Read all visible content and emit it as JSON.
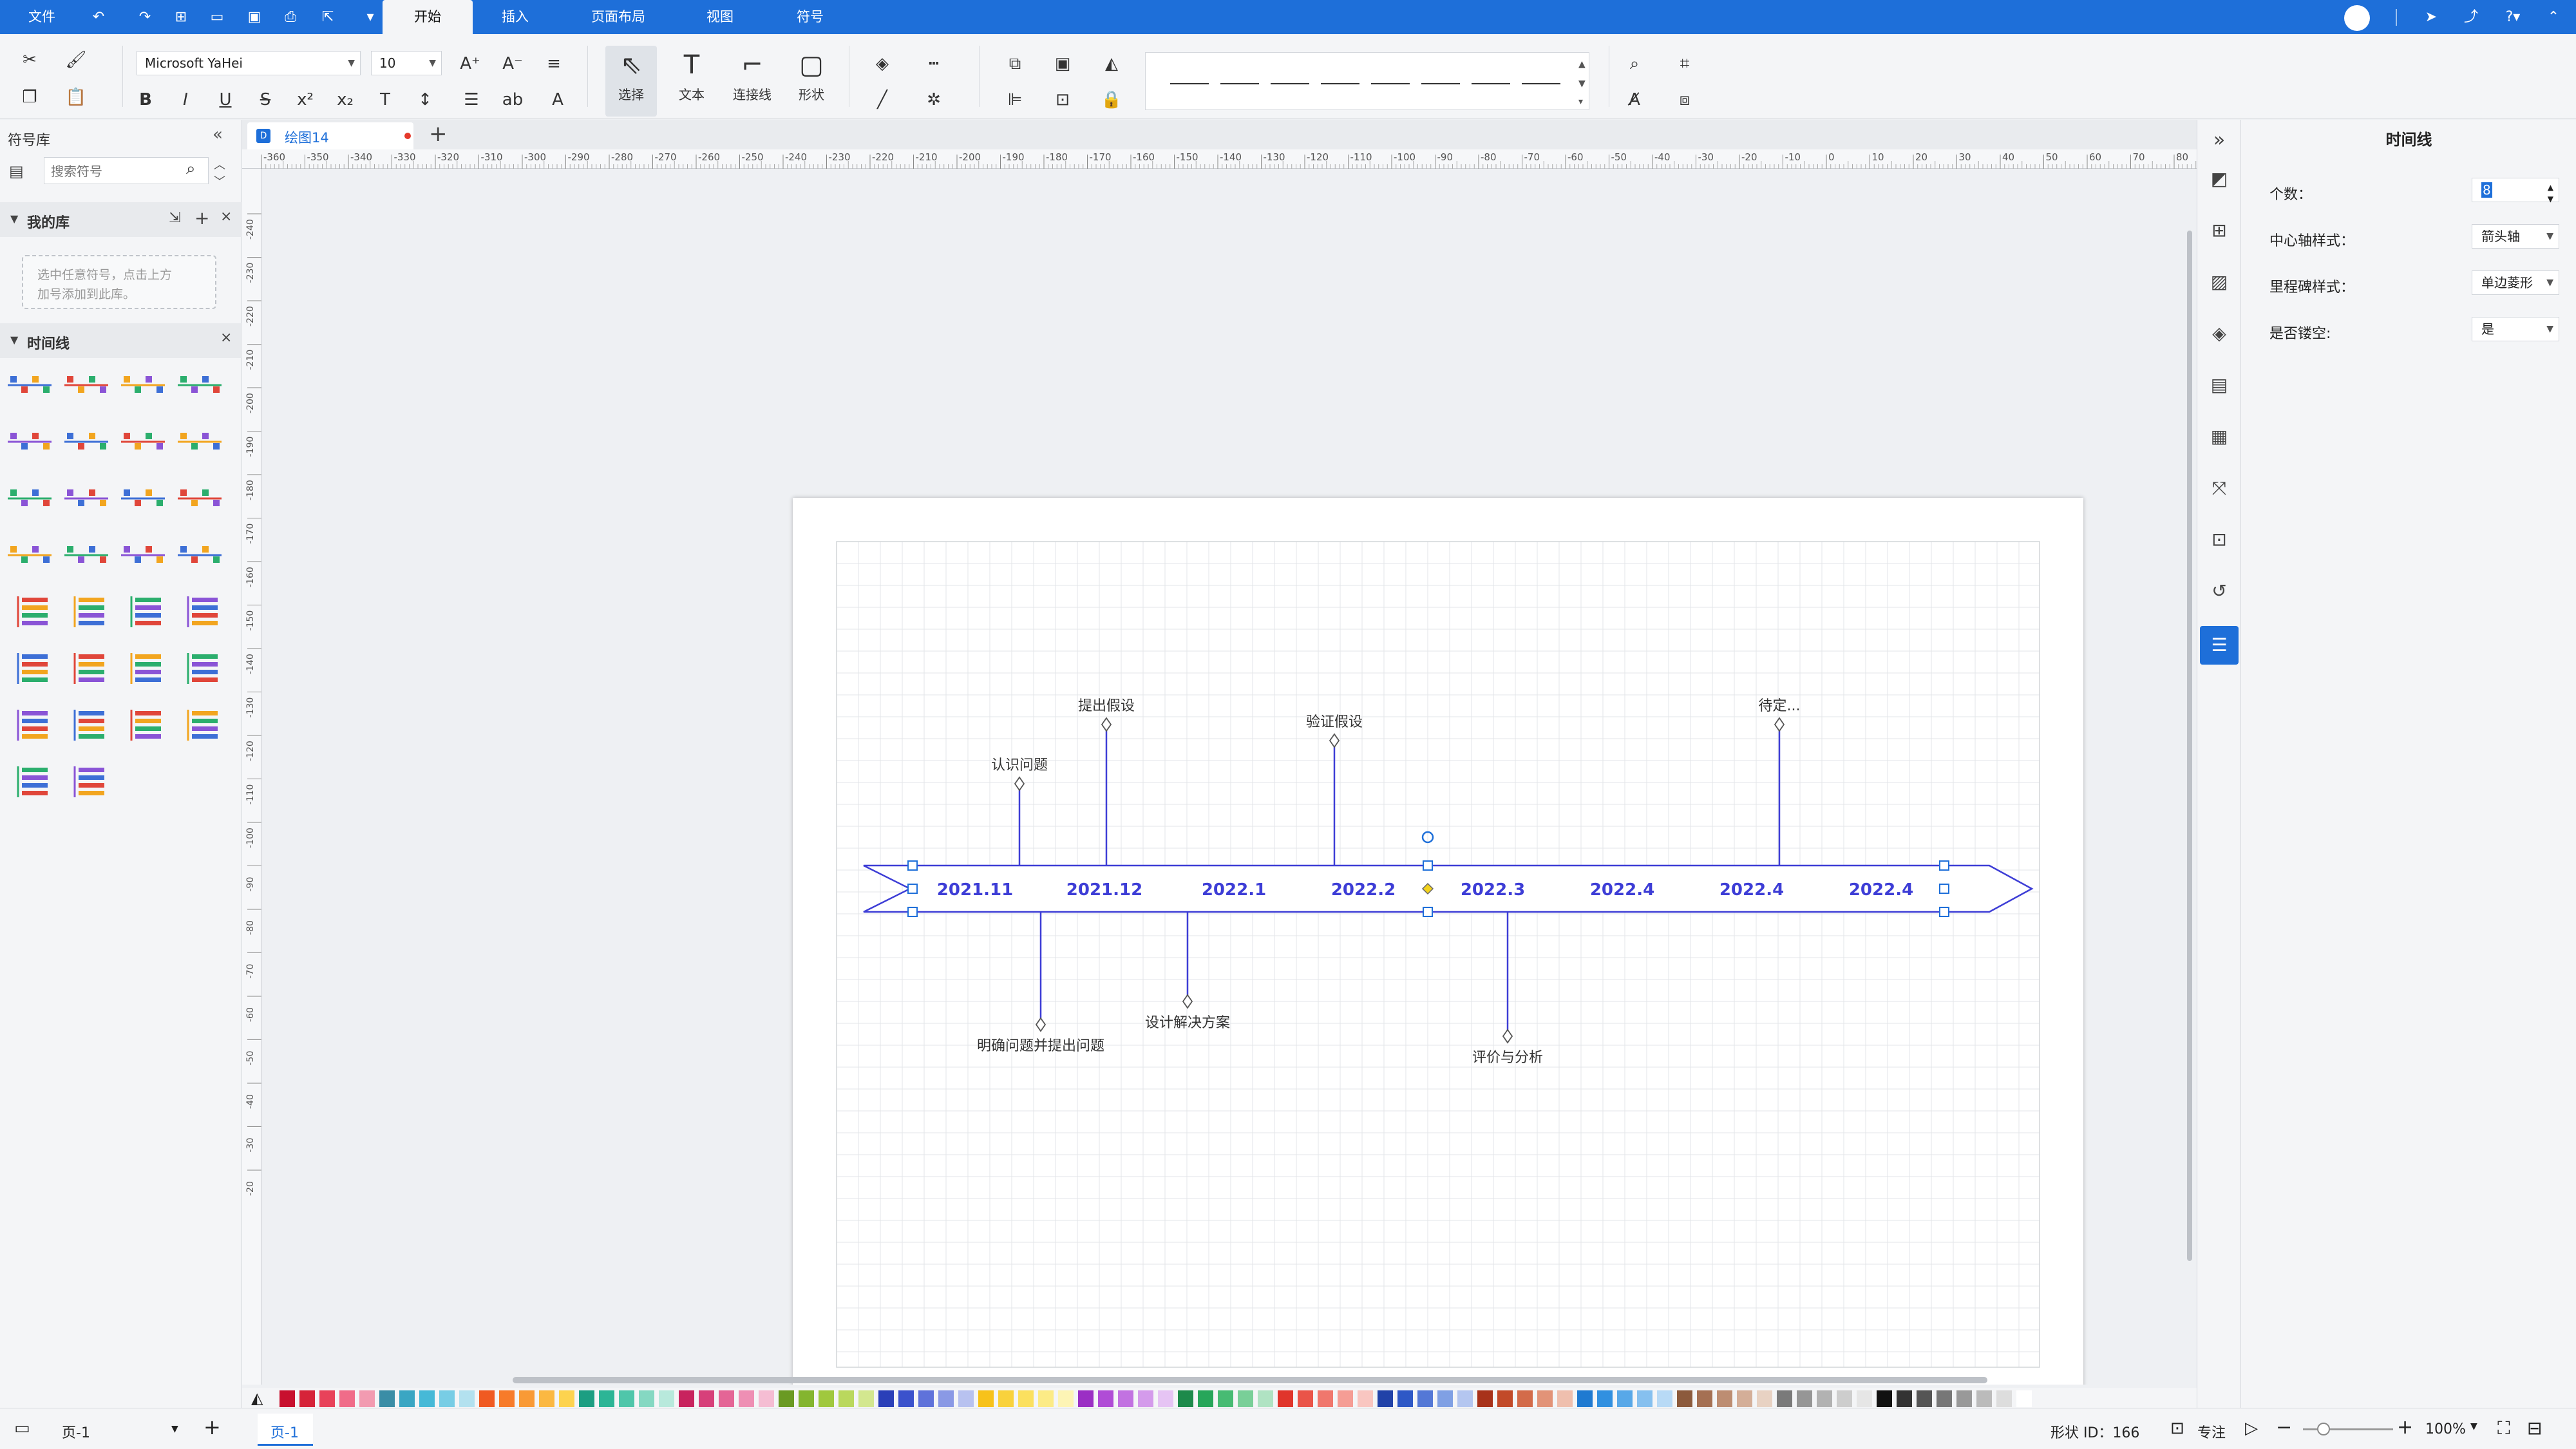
{
  "menu": {
    "file": "文件",
    "tabs": [
      {
        "label": "开始",
        "active": true
      },
      {
        "label": "插入",
        "active": false
      },
      {
        "label": "页面布局",
        "active": false
      },
      {
        "label": "视图",
        "active": false
      },
      {
        "label": "符号",
        "active": false
      }
    ]
  },
  "ribbon": {
    "font_family": "Microsoft YaHei",
    "font_size": "10",
    "select_label": "选择",
    "text_label": "文本",
    "connector_label": "连接线",
    "shape_label": "形状"
  },
  "library": {
    "title": "符号库",
    "search_placeholder": "搜索符号",
    "my_library": "我的库",
    "my_library_hint_line1": "选中任意符号，点击上方",
    "my_library_hint_line2": "加号添加到此库。",
    "timeline_section": "时间线"
  },
  "document": {
    "tab_title": "绘图14"
  },
  "ruler": {
    "h_labels": [
      "-360",
      "-350",
      "-340",
      "-330",
      "-320",
      "-310",
      "-300",
      "-290",
      "-280",
      "-270",
      "-260",
      "-250",
      "-240",
      "-230",
      "-220",
      "-210",
      "-200",
      "-190",
      "-180",
      "-170",
      "-160",
      "-150",
      "-140",
      "-130",
      "-120",
      "-110",
      "-100",
      "-90",
      "-80",
      "-70",
      "-60",
      "-50",
      "-40",
      "-30",
      "-20",
      "-10",
      "0",
      "10",
      "20",
      "30",
      "40",
      "50",
      "60",
      "70",
      "80"
    ],
    "v_labels": [
      "-240",
      "-230",
      "-220",
      "-210",
      "-200",
      "-190",
      "-180",
      "-170",
      "-160",
      "-150",
      "-140",
      "-130",
      "-120",
      "-110",
      "-100",
      "-90",
      "-80",
      "-70",
      "-60",
      "-50",
      "-40",
      "-30",
      "-20"
    ]
  },
  "timeline": {
    "dates": [
      "2021.11",
      "2021.12",
      "2022.1",
      "2022.2",
      "2022.3",
      "2022.4",
      "2022.4",
      "2022.4"
    ],
    "milestones_above": [
      "认识问题",
      "提出假设",
      "验证假设",
      "待定..."
    ],
    "milestones_below": [
      "明确问题并提出问题",
      "设计解决方案",
      "评价与分析"
    ],
    "accent_color": "#3d3dd6"
  },
  "properties": {
    "title": "时间线",
    "count_label": "个数：",
    "count_value": "8",
    "axis_style_label": "中心轴样式：",
    "axis_style_value": "箭头轴",
    "milestone_style_label": "里程碑样式：",
    "milestone_style_value": "单边菱形",
    "hollow_label": "是否镂空:",
    "hollow_value": "是"
  },
  "status": {
    "page_select": "页-1",
    "page_tab": "页-1",
    "shape_id": "形状 ID：166",
    "focus": "专注",
    "zoom": "100%"
  },
  "colors": {
    "brand": "#1e6fd9",
    "palette": [
      "#c8102e",
      "#d62339",
      "#e8425a",
      "#f06c89",
      "#f29bb1",
      "#3a8da6",
      "#3aa6c3",
      "#46b9d7",
      "#78cde5",
      "#b3e1ef",
      "#f05a22",
      "#f77b2a",
      "#f99a36",
      "#fbb842",
      "#fdd34f",
      "#1c9e82",
      "#2cb596",
      "#4fc6aa",
      "#85d8c2",
      "#b8e9dc",
      "#c8235e",
      "#d7407a",
      "#e46596",
      "#ee8fb4",
      "#f5bdd3",
      "#6a9a23",
      "#84b52f",
      "#a0c83e",
      "#bad85d",
      "#d3e78f",
      "#2a3fb8",
      "#3b52cc",
      "#5f72da",
      "#8a99e5",
      "#b8c2f0",
      "#f7c21a",
      "#f9d23c",
      "#fbe05f",
      "#fceb86",
      "#fdf4b5",
      "#9b2fc4",
      "#b04cd6",
      "#c272e1",
      "#d49beb",
      "#e6c4f4",
      "#1d8a4b",
      "#27a65a",
      "#47bb73",
      "#79cf98",
      "#b0e3c3",
      "#e0352b",
      "#ea5449",
      "#f0776d",
      "#f59d95",
      "#f9c6c1",
      "#2142a8",
      "#2e58c6",
      "#5478d6",
      "#80a0e4",
      "#b4c6f0",
      "#a8321a",
      "#c24a29",
      "#d36b4a",
      "#e29378",
      "#efbfae",
      "#1f7ad1",
      "#3190e0",
      "#58a8e8",
      "#86c0ef",
      "#b8daf6",
      "#8c5a3c",
      "#a57053",
      "#bd8d72",
      "#d4ae98",
      "#e8d2c3",
      "#7a7a7a",
      "#969696",
      "#b2b2b2",
      "#cdcdcd",
      "#e6e6e6",
      "#111111",
      "#333333",
      "#555555",
      "#777777",
      "#999999",
      "#bbbbbb",
      "#dddddd",
      "#ffffff"
    ]
  }
}
